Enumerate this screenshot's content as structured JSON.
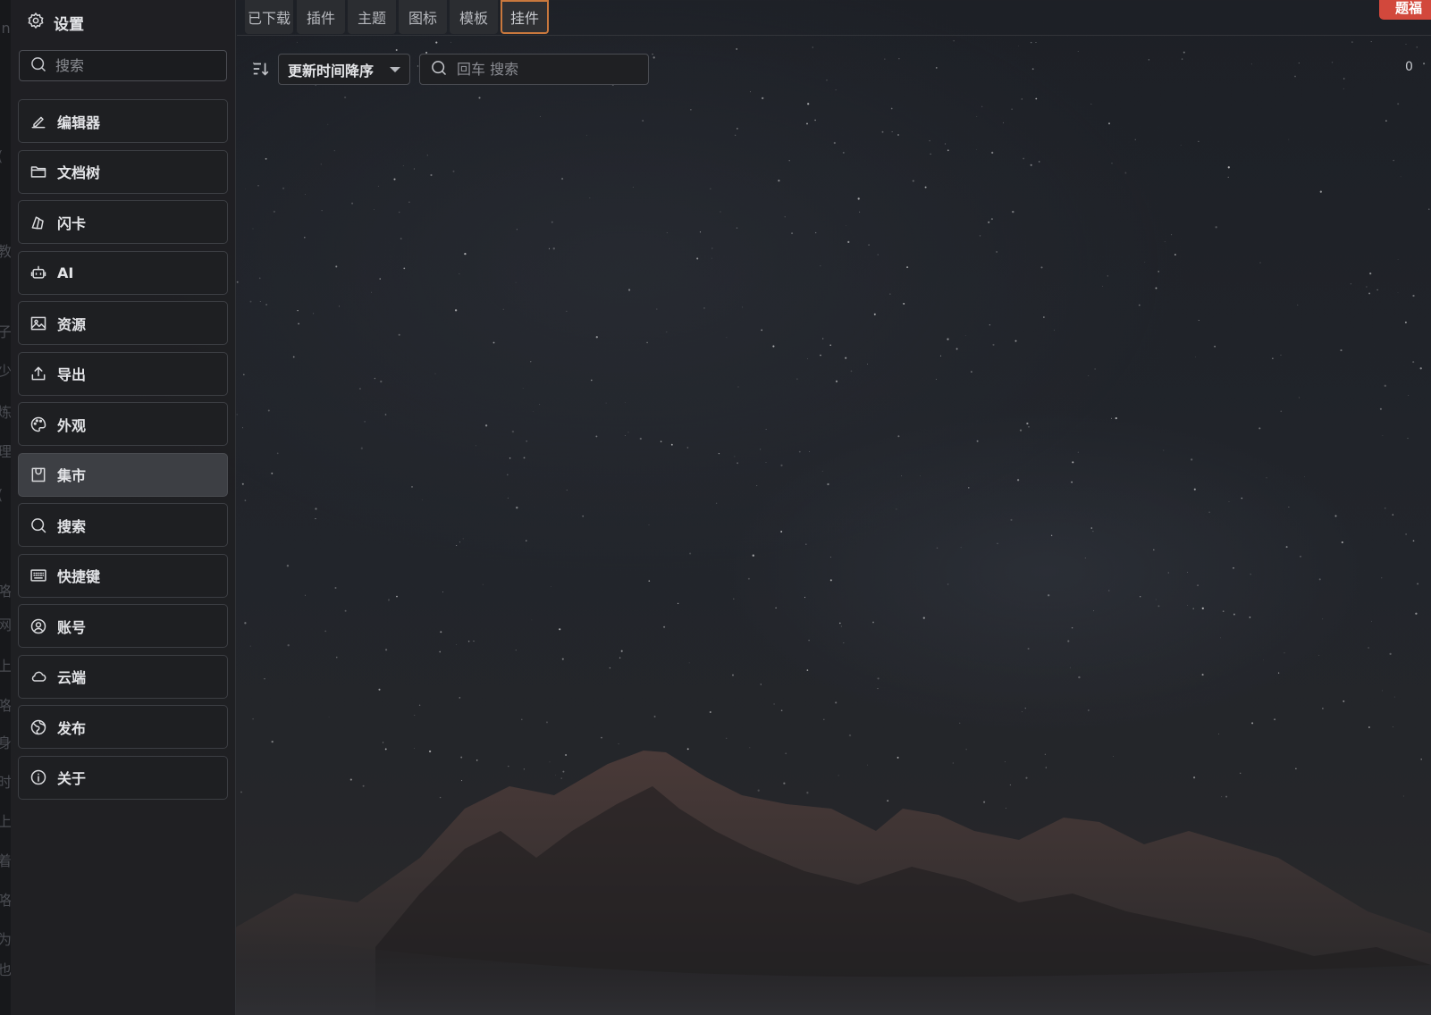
{
  "tabs": [
    {
      "label": "已下载",
      "active": false
    },
    {
      "label": "插件",
      "active": false
    },
    {
      "label": "主题",
      "active": false
    },
    {
      "label": "图标",
      "active": false
    },
    {
      "label": "模板",
      "active": false
    },
    {
      "label": "挂件",
      "active": true
    }
  ],
  "topright_button": {
    "label": "题福"
  },
  "sidebar": {
    "title": "设置",
    "title_icon": "gear-icon",
    "search_placeholder": "搜索",
    "items": [
      {
        "label": "编辑器",
        "icon": "pencil-icon",
        "active": false
      },
      {
        "label": "文档树",
        "icon": "folder-icon",
        "active": false
      },
      {
        "label": "闪卡",
        "icon": "flashcard-icon",
        "active": false
      },
      {
        "label": "AI",
        "icon": "robot-icon",
        "active": false
      },
      {
        "label": "资源",
        "icon": "image-icon",
        "active": false
      },
      {
        "label": "导出",
        "icon": "upload-icon",
        "active": false
      },
      {
        "label": "外观",
        "icon": "palette-icon",
        "active": false
      },
      {
        "label": "集市",
        "icon": "bazaar-icon",
        "active": true
      },
      {
        "label": "搜索",
        "icon": "search-icon",
        "active": false
      },
      {
        "label": "快捷键",
        "icon": "keyboard-icon",
        "active": false
      },
      {
        "label": "账号",
        "icon": "account-icon",
        "active": false
      },
      {
        "label": "云端",
        "icon": "cloud-icon",
        "active": false
      },
      {
        "label": "发布",
        "icon": "globe-icon",
        "active": false
      },
      {
        "label": "关于",
        "icon": "info-icon",
        "active": false
      }
    ]
  },
  "filter": {
    "sort_value": "更新时间降序",
    "search_placeholder": "回车 搜索",
    "count": "0"
  },
  "background_strip_chars": [
    "in",
    "(",
    "教",
    "子",
    "少",
    "炼",
    "理",
    "(",
    "咯",
    "网",
    "上",
    "咯",
    "身",
    "时",
    "上",
    "着",
    "咯",
    "为",
    "也"
  ],
  "colors": {
    "accent_tab_border": "#c9783d",
    "topright_button": "#d2483c",
    "sidebar_bg": "#1f2023",
    "active_item_bg": "#3d3f44"
  }
}
